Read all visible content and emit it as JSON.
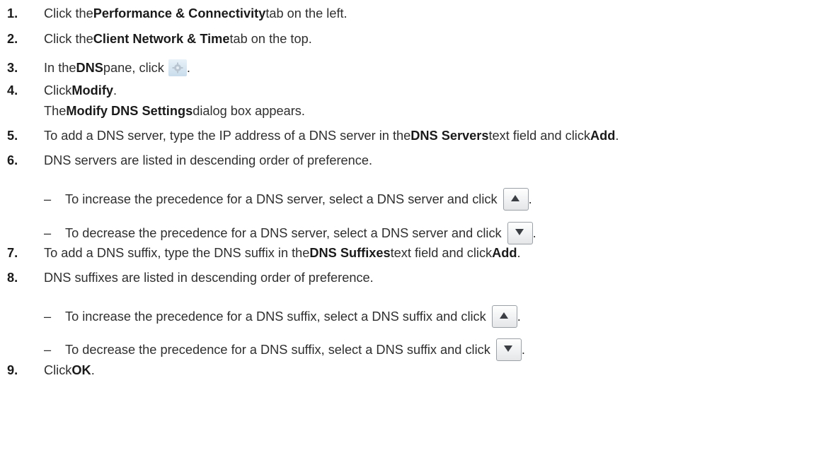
{
  "steps": [
    {
      "num": "1.",
      "pre": "Click the ",
      "bold": "Performance & Connectivity",
      "post": " tab on the left."
    },
    {
      "num": "2.",
      "pre": "Click the ",
      "bold": "Client Network & Time",
      "post": " tab on the top."
    },
    {
      "num": "3.",
      "pre": "In the ",
      "bold": "DNS",
      "post": " pane, click",
      "icon": "gear-icon",
      "tail": "."
    },
    {
      "num": "4.",
      "pre": "Click ",
      "bold": "Modify",
      "post": ".",
      "note_pre": "The ",
      "note_bold": "Modify DNS Settings",
      "note_post": " dialog box appears."
    },
    {
      "num": "5.",
      "pre": "To add a DNS server, type the IP address of a DNS server in the ",
      "bold": "DNS Servers",
      "post": " text field and click ",
      "bold2": "Add",
      "post2": "."
    },
    {
      "num": "6.",
      "text": "DNS servers are listed in descending order of preference.",
      "sub": [
        {
          "dash": "–",
          "text": "To increase the precedence for a DNS server, select a DNS server and click",
          "icon": "arrow-up-icon",
          "tail": "."
        },
        {
          "dash": "–",
          "text": "To decrease the precedence for a DNS server, select a DNS server and click",
          "icon": "arrow-down-icon",
          "tail": "."
        }
      ]
    },
    {
      "num": "7.",
      "pre": "To add a DNS suffix, type the DNS suffix in the ",
      "bold": "DNS Suffixes",
      "post": " text field and click ",
      "bold2": "Add",
      "post2": "."
    },
    {
      "num": "8.",
      "text": "DNS suffixes are listed in descending order of preference.",
      "sub": [
        {
          "dash": "–",
          "text": "To increase the precedence for a DNS suffix, select a DNS suffix and click",
          "icon": "arrow-up-icon",
          "tail": "."
        },
        {
          "dash": "–",
          "text": "To decrease the precedence for a DNS suffix, select a DNS suffix and click",
          "icon": "arrow-down-icon",
          "tail": "."
        }
      ]
    },
    {
      "num": "9.",
      "pre": "Click ",
      "bold": "OK",
      "post": "."
    }
  ]
}
